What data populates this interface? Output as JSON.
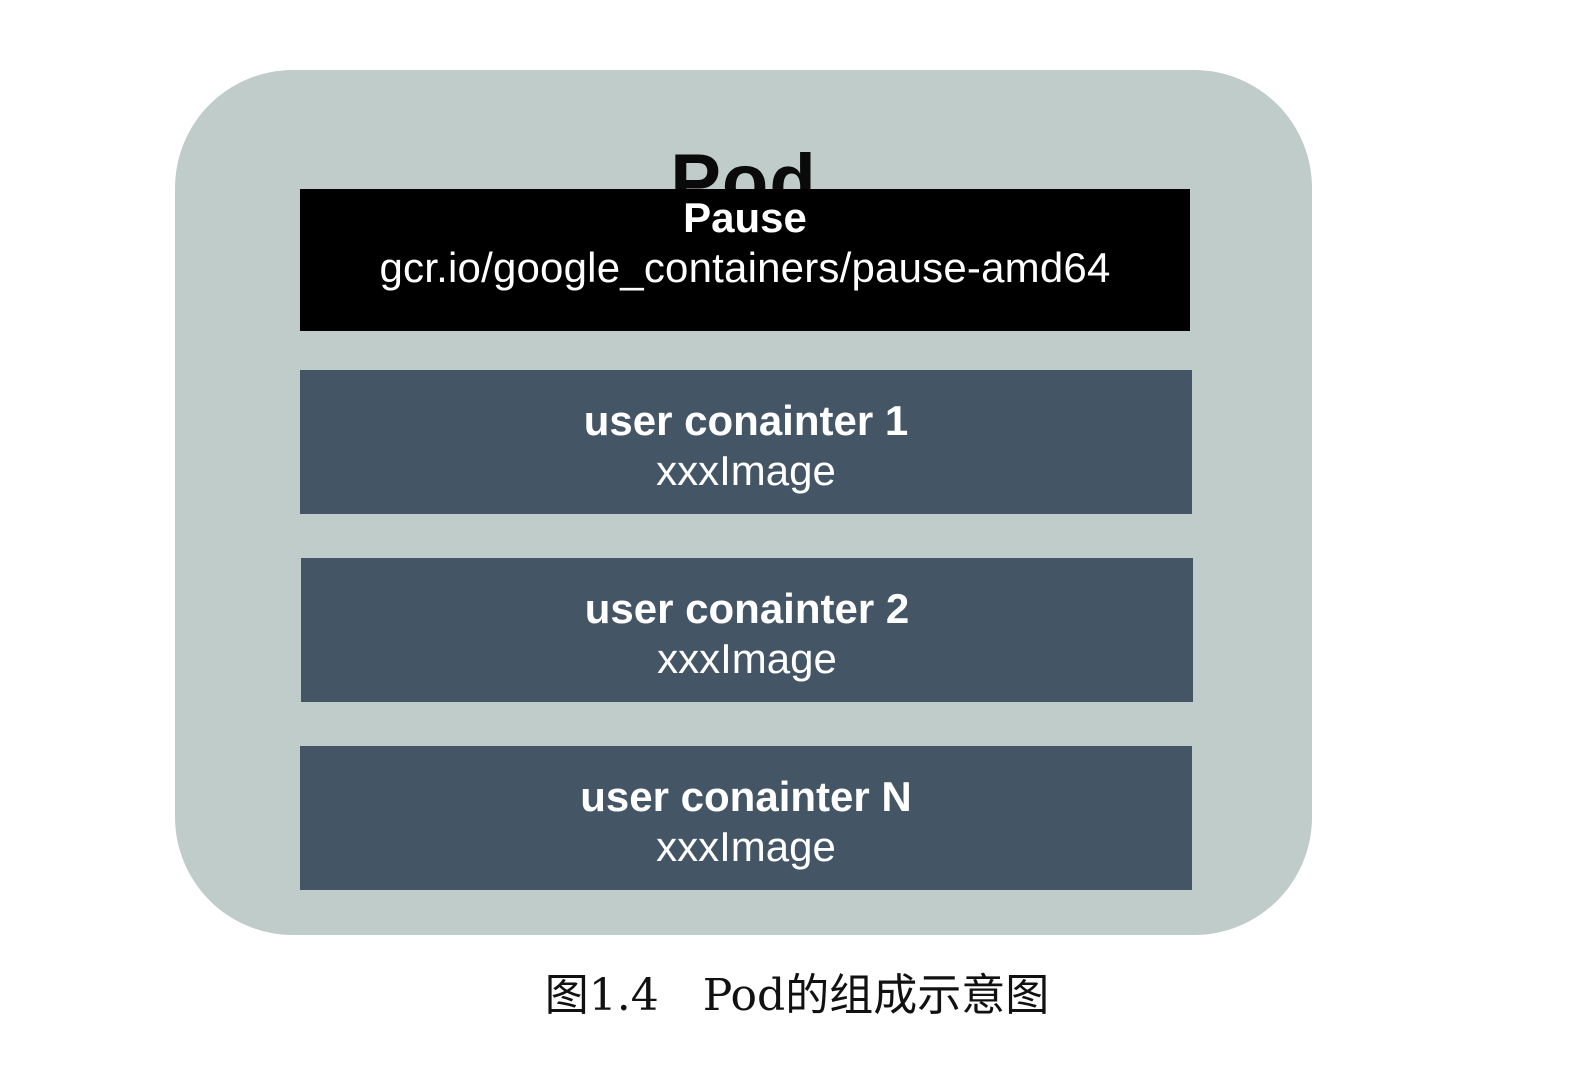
{
  "pod": {
    "title": "Pod",
    "pause": {
      "name": "Pause",
      "image": "gcr.io/google_containers/pause-amd64"
    },
    "containers": [
      {
        "name": "user conainter 1",
        "image": "xxxImage"
      },
      {
        "name": "user conainter 2",
        "image": "xxxImage"
      },
      {
        "name": "user conainter N",
        "image": "xxxImage"
      }
    ]
  },
  "caption": "图1.4　Pod的组成示意图",
  "colors": {
    "pod_background": "#bfccc9",
    "pause_background": "#000000",
    "container_background": "#445566",
    "text_light": "#ffffff",
    "text_dark": "#0a0a0a"
  }
}
